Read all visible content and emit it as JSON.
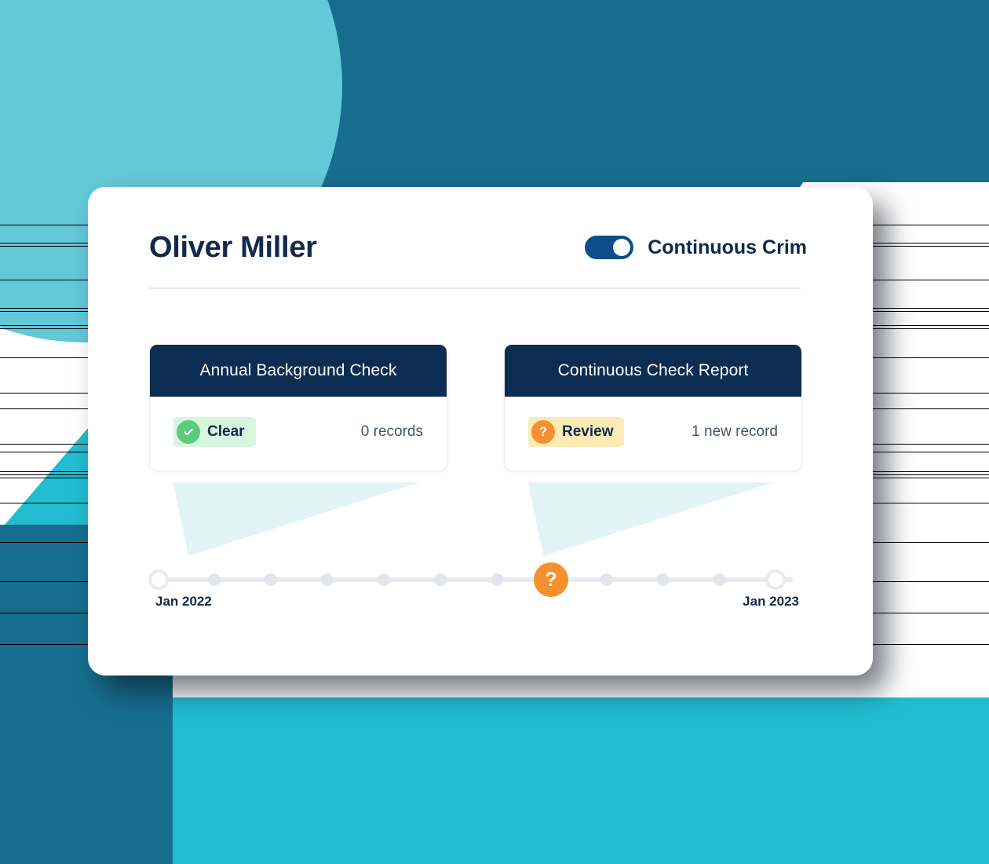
{
  "header": {
    "person_name": "Oliver Miller",
    "toggle": {
      "label": "Continuous Crim",
      "state": "on",
      "color": "#0B4E8A"
    }
  },
  "reports": [
    {
      "title": "Annual Background Check",
      "status_label": "Clear",
      "status_icon": "check-icon",
      "status_color": "#5CCB7C",
      "status_pill_color": "#D8F5E0",
      "record_count": "0 records"
    },
    {
      "title": "Continuous Check Report",
      "status_label": "Review",
      "status_icon": "question-icon",
      "status_color": "#F4902E",
      "status_pill_color": "#FCEBB4",
      "record_count": "1 new record"
    }
  ],
  "timeline": {
    "start_label": "Jan 2022",
    "end_label": "Jan 2023",
    "flag_icon": "question-icon",
    "flag_symbol": "?",
    "flag_color": "#F4902E",
    "flag_position_percent": 61.5,
    "nodes": [
      {
        "type": "ring",
        "position_percent": 0
      },
      {
        "type": "dot",
        "position_percent": 8.8
      },
      {
        "type": "dot",
        "position_percent": 17.7
      },
      {
        "type": "dot",
        "position_percent": 26.6
      },
      {
        "type": "dot",
        "position_percent": 35.5
      },
      {
        "type": "dot",
        "position_percent": 44.4
      },
      {
        "type": "dot",
        "position_percent": 53.3
      },
      {
        "type": "flag",
        "position_percent": 61.5
      },
      {
        "type": "dot",
        "position_percent": 71.0
      },
      {
        "type": "dot",
        "position_percent": 79.9
      },
      {
        "type": "dot",
        "position_percent": 88.8
      },
      {
        "type": "ring",
        "position_percent": 100
      }
    ]
  },
  "theme": {
    "navy": "#0C2D52",
    "title_navy": "#11294A",
    "dark_teal": "#176D8E",
    "light_teal": "#63C8D8",
    "cyan": "#22BCD0",
    "mint_shadow": "#E2F4F5",
    "divider": "#E4E8EF",
    "muted_text": "#44546A"
  }
}
